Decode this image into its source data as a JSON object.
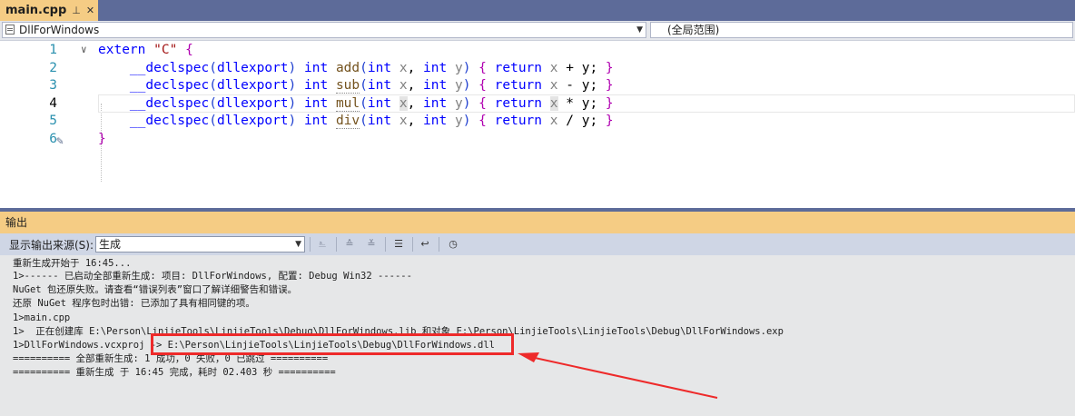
{
  "tab": {
    "title": "main.cpp",
    "pin_glyph": "⊥",
    "close_glyph": "✕"
  },
  "navbar": {
    "project": "DllForWindows",
    "scope": "(全局范围)"
  },
  "editor": {
    "line_numbers": [
      "1",
      "2",
      "3",
      "4",
      "5",
      "6"
    ],
    "code": {
      "l1": {
        "kw": "extern",
        "str": "\"C\"",
        "brace": "{"
      },
      "l2": {
        "decl": "__declspec",
        "arg": "dllexport",
        "type": "int",
        "name": "add",
        "op": "+"
      },
      "l3": {
        "decl": "__declspec",
        "arg": "dllexport",
        "type": "int",
        "name": "sub",
        "op": "-"
      },
      "l4": {
        "decl": "__declspec",
        "arg": "dllexport",
        "type": "int",
        "name": "mul",
        "op": "*"
      },
      "l5": {
        "decl": "__declspec",
        "arg": "dllexport",
        "type": "int",
        "name": "div",
        "op": "/"
      },
      "l6": {
        "brace": "}"
      },
      "common": {
        "p1": "int",
        "x": "x",
        "p2": "int",
        "y": "y",
        "ret": "return"
      }
    }
  },
  "output": {
    "title": "输出",
    "source_label": "显示输出来源(S):",
    "source_value": "生成",
    "lines": [
      "重新生成开始于 16:45...",
      "1>------ 已启动全部重新生成: 项目: DllForWindows, 配置: Debug Win32 ------",
      "NuGet 包还原失败。请查看“错误列表”窗口了解详细警告和错误。",
      "还原 NuGet 程序包时出错: 已添加了具有相同键的项。",
      "1>main.cpp",
      "1>  正在创建库 E:\\Person\\LinjieTools\\LinjieTools\\Debug\\DllForWindows.lib 和对象 E:\\Person\\LinjieTools\\LinjieTools\\Debug\\DllForWindows.exp",
      "1>DllForWindows.vcxproj -> E:\\Person\\LinjieTools\\LinjieTools\\Debug\\DllForWindows.dll",
      "========== 全部重新生成: 1 成功，0 失败，0 已跳过 ==========",
      "========== 重新生成 于 16:45 完成，耗时 02.403 秒 =========="
    ]
  },
  "colors": {
    "tab_active": "#f5cc84",
    "frame": "#5d6b99",
    "highlight": "#ee2a2a"
  }
}
